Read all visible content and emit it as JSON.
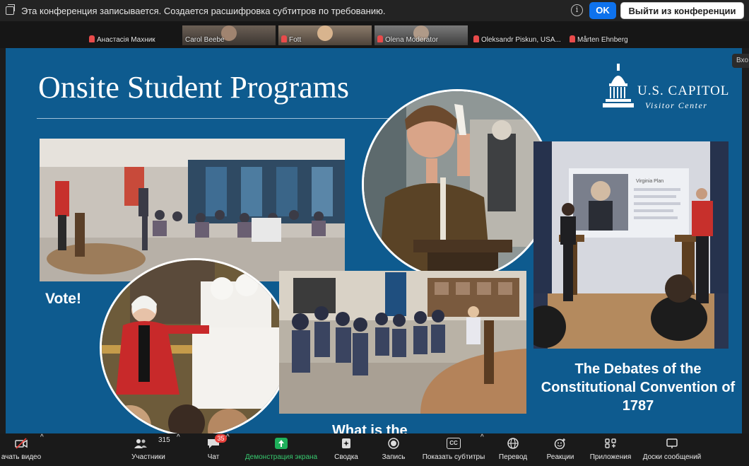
{
  "banner": {
    "message": "Эта конференция записывается. Создается расшифровка субтитров по требованию.",
    "ok_label": "OK",
    "leave_label": "Выйти из конференции"
  },
  "participants": [
    {
      "name": "Анастасія Махник",
      "muted": true
    },
    {
      "name": "Carol Beebe",
      "muted": false
    },
    {
      "name": "Fott",
      "muted": true
    },
    {
      "name": "Olena Moderator",
      "muted": true
    },
    {
      "name": "Oleksandr Piskun, USA...",
      "muted": true
    },
    {
      "name": "Mårten Ehnberg",
      "muted": true
    }
  ],
  "side_tab": "Вхо",
  "slide": {
    "title": "Onsite Student Programs",
    "logo_line1": "U.S. CAPITOL",
    "logo_line2": "Visitor Center",
    "caption_vote": "Vote!",
    "caption_debates": "The Debates of the Constitutional Convention of 1787",
    "caption_whatis": "What is the",
    "screen_text": "Virginia Plan"
  },
  "toolbar": {
    "video": "ачать видео",
    "participants": "Участники",
    "participants_count": "315",
    "chat": "Чат",
    "chat_badge": "35",
    "share": "Демонстрация экрана",
    "summary": "Сводка",
    "record": "Запись",
    "captions": "Показать субтитры",
    "captions_icon_text": "CC",
    "translate": "Перевод",
    "reactions": "Реакции",
    "apps": "Приложения",
    "whiteboards": "Доски сообщений"
  },
  "colors": {
    "slide_bg": "#0e5b8f",
    "ok_button": "#0e72ed",
    "share_green": "#1fb05b",
    "badge_red": "#e8413c"
  }
}
